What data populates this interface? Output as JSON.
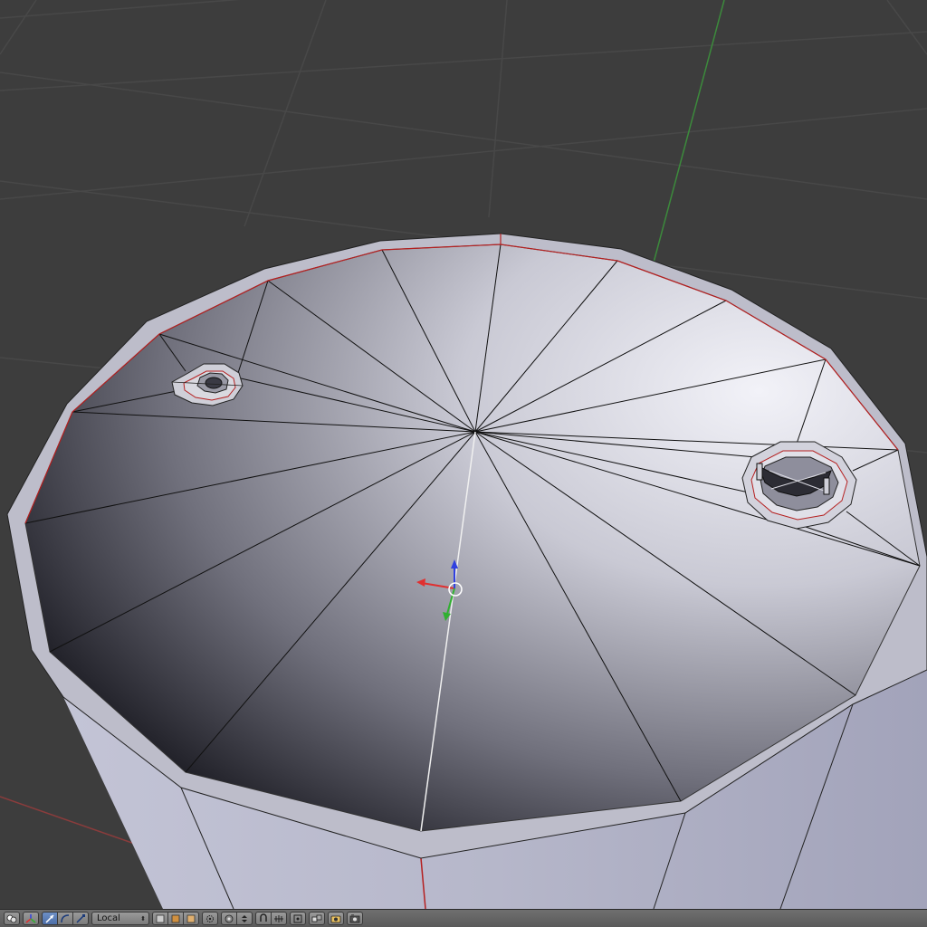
{
  "scene": {
    "background_color": "#3d3d3d",
    "grid_color": "#484848",
    "axis_y_color": "#3c8a3c",
    "axis_x_color": "#8a3c3c",
    "mesh_light": "#d8d8e2",
    "mesh_dark": "#1e1e26",
    "rim_color": "#bdbdca",
    "edge_color": "#111111",
    "seam_color": "#b52020"
  },
  "manipulator": {
    "x_color": "#e03030",
    "y_color": "#30b030",
    "z_color": "#3040e0"
  },
  "toolbar": {
    "orientation_value": "Local",
    "orientation_arrows": "⬍",
    "icons": [
      "viewport-shading-icon",
      "manipulator-toggle-icon",
      "translate-icon",
      "rotate-icon",
      "scale-icon",
      "layer-solid-icon",
      "layer-textured-icon",
      "layer-material-icon",
      "pivot-icon",
      "proportional-edit-icon",
      "snap-icon",
      "snap-target-icon",
      "mirror-icon",
      "overlay-icon",
      "render-image-icon",
      "render-animation-icon"
    ]
  }
}
